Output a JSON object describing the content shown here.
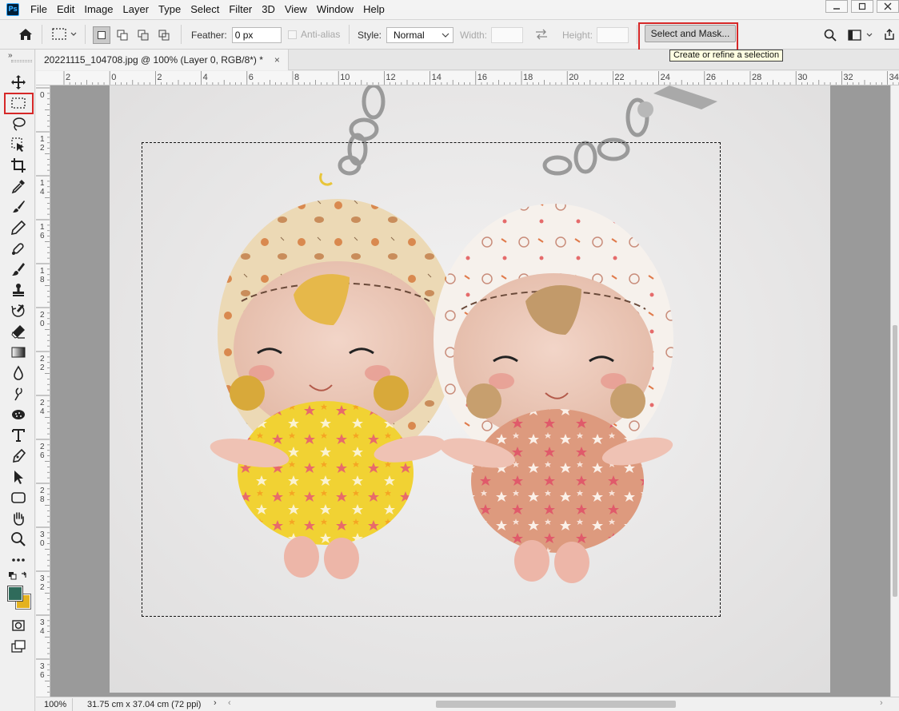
{
  "app": {
    "logo": "Ps",
    "menu": [
      "File",
      "Edit",
      "Image",
      "Layer",
      "Type",
      "Select",
      "Filter",
      "3D",
      "View",
      "Window",
      "Help"
    ],
    "window_controls": [
      "minimize-icon",
      "maximize-icon",
      "close-icon"
    ]
  },
  "options": {
    "feather_label": "Feather:",
    "feather_value": "0 px",
    "antialias_label": "Anti-alias",
    "style_label": "Style:",
    "style_value": "Normal",
    "width_label": "Width:",
    "height_label": "Height:",
    "select_mask_label": "Select and Mask...",
    "tooltip": "Create or refine a selection"
  },
  "document": {
    "tab_title": "20221115_104708.jpg @ 100% (Layer 0, RGB/8*) *",
    "close_glyph": "×"
  },
  "rulers": {
    "top": [
      "2",
      "0",
      "2",
      "4",
      "6",
      "8",
      "10",
      "12",
      "14",
      "16",
      "18",
      "20",
      "22",
      "24",
      "26",
      "28",
      "30",
      "32",
      "34"
    ],
    "left": [
      "0",
      "1 2",
      "1 4",
      "1 6",
      "1 8",
      "2 0",
      "2 2",
      "2 4",
      "2 6",
      "2 8",
      "3 0",
      "3 2",
      "3 4",
      "3 6"
    ]
  },
  "status": {
    "zoom": "100%",
    "doc_size": "31.75 cm x 37.04 cm (72 ppi)",
    "arrow": "›"
  },
  "colors": {
    "foreground": "#2f6b5b",
    "background": "#e4b21f",
    "highlight": "#d62828"
  }
}
